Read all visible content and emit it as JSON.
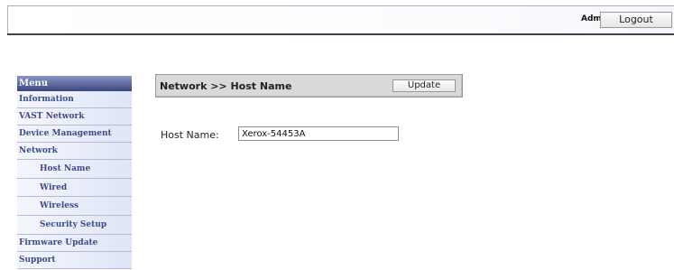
{
  "header": {
    "user_label": "Admin",
    "logout_label": "Logout"
  },
  "menu": {
    "title": "Menu",
    "items": [
      {
        "label": "Information"
      },
      {
        "label": "VAST Network"
      },
      {
        "label": "Device Management"
      },
      {
        "label": "Network"
      },
      {
        "label": "Host Name"
      },
      {
        "label": "Wired"
      },
      {
        "label": "Wireless"
      },
      {
        "label": "Security Setup"
      },
      {
        "label": "Firmware Update"
      },
      {
        "label": "Support"
      }
    ]
  },
  "panel": {
    "breadcrumb": "Network >> Host Name",
    "update_label": "Update"
  },
  "form": {
    "host_name_label": "Host Name:",
    "host_name_value": "Xerox-54453A"
  }
}
